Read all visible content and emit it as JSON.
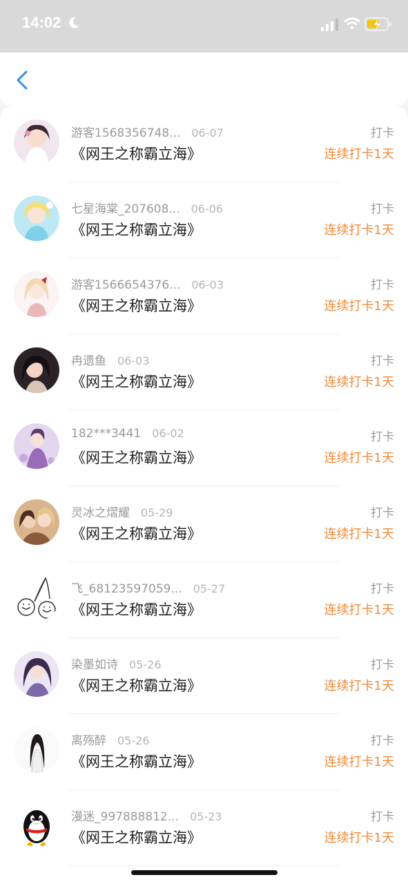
{
  "status": {
    "time": "14:02"
  },
  "rows": [
    {
      "name": "游客1568356748...",
      "date": "06-07",
      "title": "《网王之称霸立海》",
      "action": "打卡",
      "streak": "连续打卡1天",
      "avatar": "anime-girl-white-dress"
    },
    {
      "name": "七星海棠_207608...",
      "date": "06-06",
      "title": "《网王之称霸立海》",
      "action": "打卡",
      "streak": "连续打卡1天",
      "avatar": "anime-girl-blue"
    },
    {
      "name": "游客1566654376...",
      "date": "06-03",
      "title": "《网王之称霸立海》",
      "action": "打卡",
      "streak": "连续打卡1天",
      "avatar": "anime-girl-red-bow"
    },
    {
      "name": "冉遗鱼",
      "date": "06-03",
      "title": "《网王之称霸立海》",
      "action": "打卡",
      "streak": "连续打卡1天",
      "avatar": "anime-girl-dark-hair"
    },
    {
      "name": "182***3441",
      "date": "06-02",
      "title": "《网王之称霸立海》",
      "action": "打卡",
      "streak": "连续打卡1天",
      "avatar": "anime-girl-purple"
    },
    {
      "name": "灵冰之熠耀",
      "date": "05-29",
      "title": "《网王之称霸立海》",
      "action": "打卡",
      "streak": "连续打卡1天",
      "avatar": "anime-couple"
    },
    {
      "name": "飞_68123597059...",
      "date": "05-27",
      "title": "《网王之称霸立海》",
      "action": "打卡",
      "streak": "连续打卡1天",
      "avatar": "cherry-doodle"
    },
    {
      "name": "染墨如诗",
      "date": "05-26",
      "title": "《网王之称霸立海》",
      "action": "打卡",
      "streak": "连续打卡1天",
      "avatar": "anime-girl-violet"
    },
    {
      "name": "离殇醉",
      "date": "05-26",
      "title": "《网王之称霸立海》",
      "action": "打卡",
      "streak": "连续打卡1天",
      "avatar": "anime-girl-long-black-hair"
    },
    {
      "name": "漫迷_997888812...",
      "date": "05-23",
      "title": "《网王之称霸立海》",
      "action": "打卡",
      "streak": "连续打卡1天",
      "avatar": "penguin"
    }
  ],
  "colors": {
    "accent_orange": "#ee8a3b",
    "back_blue": "#2f8fe8"
  }
}
